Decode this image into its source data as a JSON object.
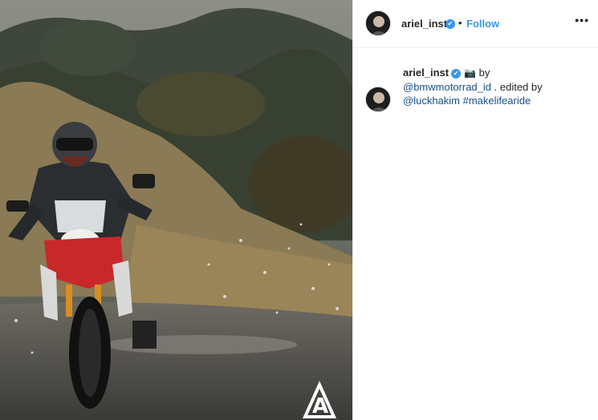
{
  "post": {
    "author": "ariel_inst",
    "separator": "•",
    "follow_label": "Follow",
    "more_label": "•••",
    "verified_glyph": "✔"
  },
  "caption": {
    "author": "ariel_inst",
    "camera_glyph": "📷",
    "by_text": "by",
    "mention1": "@bmwmotorrad_id",
    "mid_text": ". edited by",
    "mention2": "@luckhakim",
    "hashtag": "#makelifearide"
  },
  "photo": {
    "watermark": "A"
  },
  "colors": {
    "accent": "#3897f0",
    "mention": "#1b4f8a",
    "text": "#262626"
  }
}
